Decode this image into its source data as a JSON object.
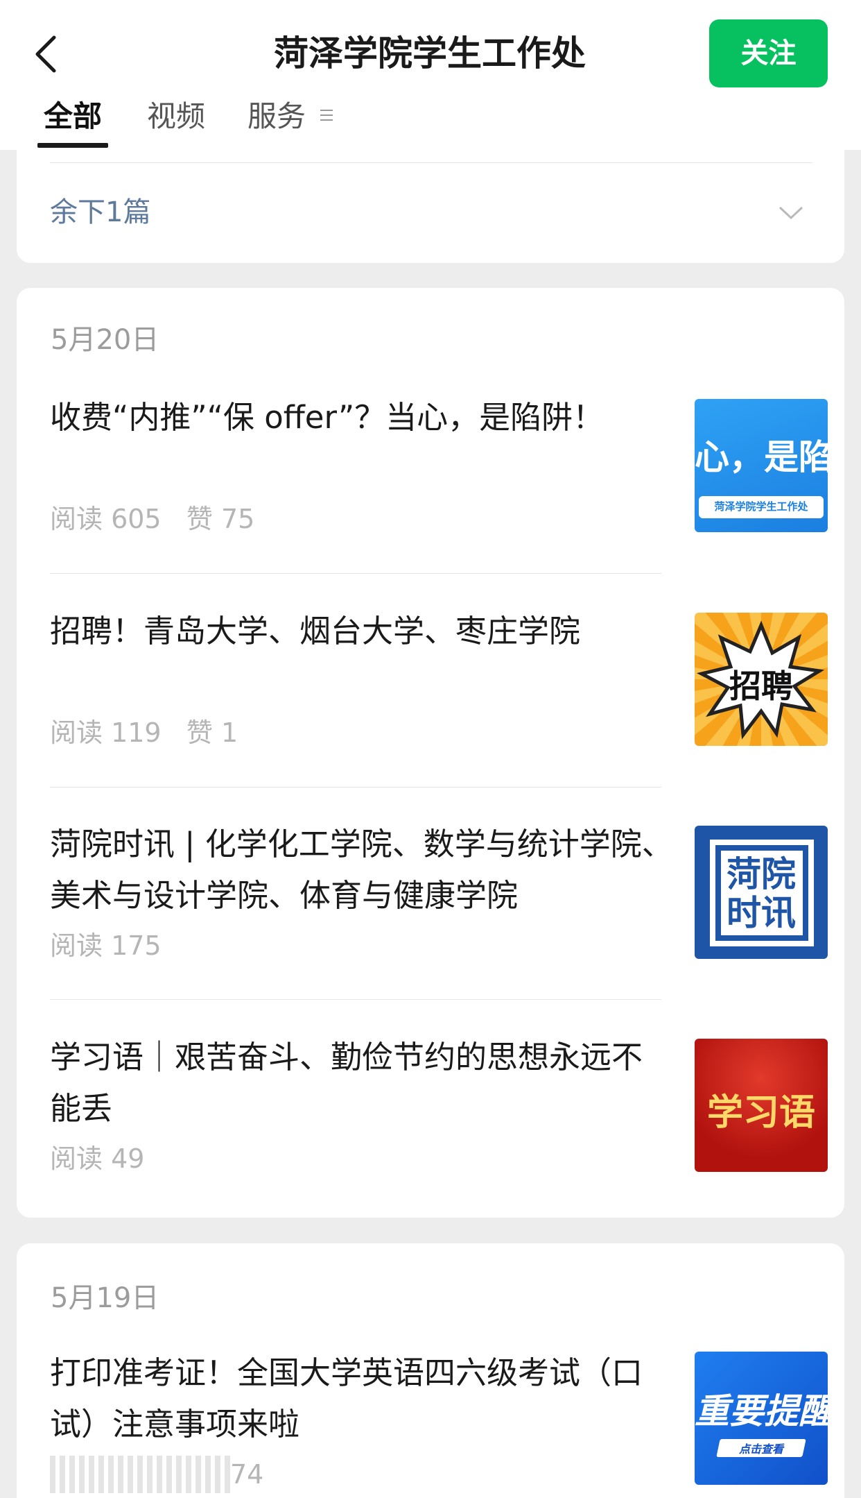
{
  "header": {
    "title": "菏泽学院学生工作处",
    "follow_label": "关注",
    "accent_color": "#07c160"
  },
  "tabs": [
    {
      "label": "全部",
      "active": true
    },
    {
      "label": "视频",
      "active": false
    },
    {
      "label": "服务",
      "active": false
    }
  ],
  "top_card": {
    "remaining_label": "余下1篇"
  },
  "groups": [
    {
      "date": "5月20日",
      "articles": [
        {
          "title": "收费“内推”“保 offer”？当心，是陷阱！",
          "reads": "阅读 605",
          "likes": "赞 75",
          "thumb_text": "心，是陷",
          "thumb_sub": "菏泽学院学生工作处",
          "thumb_icon": "article-thumbnail"
        },
        {
          "title": "招聘！青岛大学、烟台大学、枣庄学院",
          "reads": "阅读 119",
          "likes": "赞 1",
          "thumb_text": "招聘",
          "thumb_icon": "article-thumbnail"
        },
        {
          "title": "菏院时讯 | 化学化工学院、数学与统计学院、美术与设计学院、体育与健康学院",
          "reads": "阅读 175",
          "likes": "",
          "thumb_text_line1": "菏院",
          "thumb_text_line2": "时讯",
          "thumb_icon": "article-thumbnail"
        },
        {
          "title": "学习语｜艰苦奋斗、勤俭节约的思想永远不能丢",
          "reads": "阅读 49",
          "likes": "",
          "thumb_text": "学习语",
          "thumb_icon": "article-thumbnail"
        }
      ]
    },
    {
      "date": "5月19日",
      "articles": [
        {
          "title": "打印准考证！全国大学英语四六级考试（口试）注意事项来啦",
          "reads": "74",
          "likes": "",
          "thumb_text": "重要提醒",
          "thumb_sub": "点击查看",
          "thumb_icon": "article-thumbnail"
        }
      ]
    }
  ]
}
